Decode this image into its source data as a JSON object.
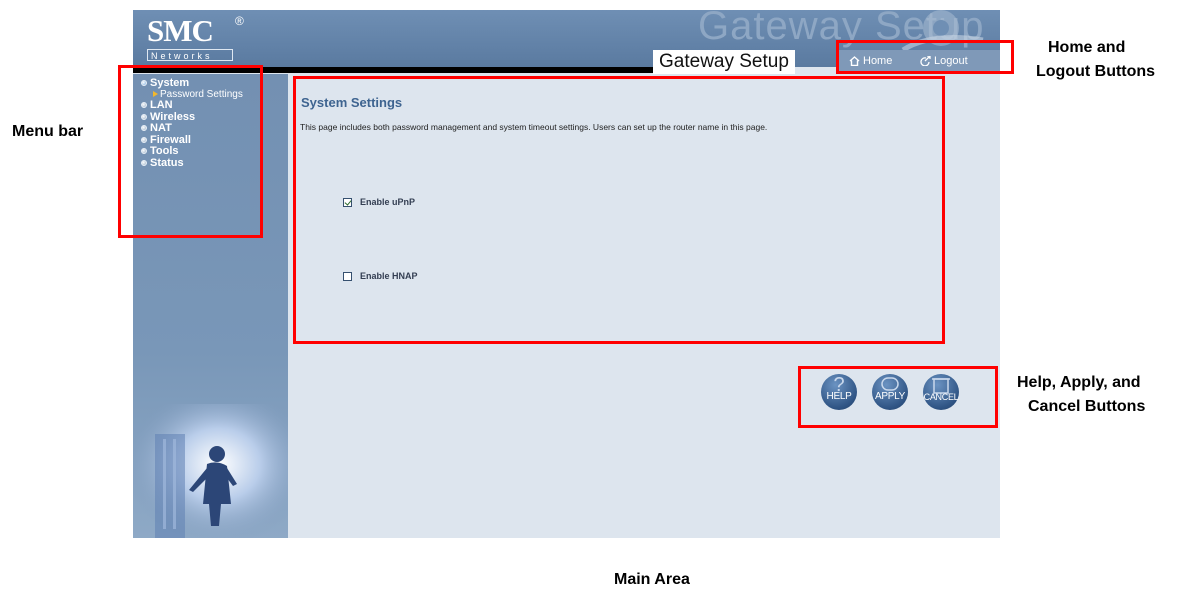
{
  "header": {
    "logo_text": "SMC",
    "logo_mark": "®",
    "logo_sub": "Networks",
    "watermark_text": "Gateway Setup",
    "title": "Gateway Setup",
    "home_label": "Home",
    "logout_label": "Logout"
  },
  "sidebar": {
    "items": [
      {
        "label": "System",
        "icon": "bullet-icon"
      },
      {
        "label": "Password Settings",
        "icon": "arrow-icon"
      },
      {
        "label": "LAN",
        "icon": "bullet-icon"
      },
      {
        "label": "Wireless",
        "icon": "bullet-icon"
      },
      {
        "label": "NAT",
        "icon": "bullet-icon"
      },
      {
        "label": "Firewall",
        "icon": "bullet-icon"
      },
      {
        "label": "Tools",
        "icon": "bullet-icon"
      },
      {
        "label": "Status",
        "icon": "bullet-icon"
      }
    ]
  },
  "main": {
    "title": "System Settings",
    "description": "This page includes both password management and system timeout settings. Users can set up the router name in this page.",
    "options": [
      {
        "label": "Enable uPnP",
        "checked": true
      },
      {
        "label": "Enable HNAP",
        "checked": false
      }
    ],
    "buttons": {
      "help": "HELP",
      "apply": "APPLY",
      "cancel": "CANCEL"
    }
  },
  "annotations": {
    "menu_bar": "Menu bar",
    "home_logout_line1": "Home and",
    "home_logout_line2": "Logout Buttons",
    "actions_line1": "Help, Apply, and",
    "actions_line2": "Cancel Buttons",
    "main_area": "Main Area"
  },
  "colors": {
    "annotation_red": "#ff0000",
    "header_blue": "#5f7fa6",
    "content_bg": "#dde5ee",
    "title_blue": "#3e6490"
  }
}
